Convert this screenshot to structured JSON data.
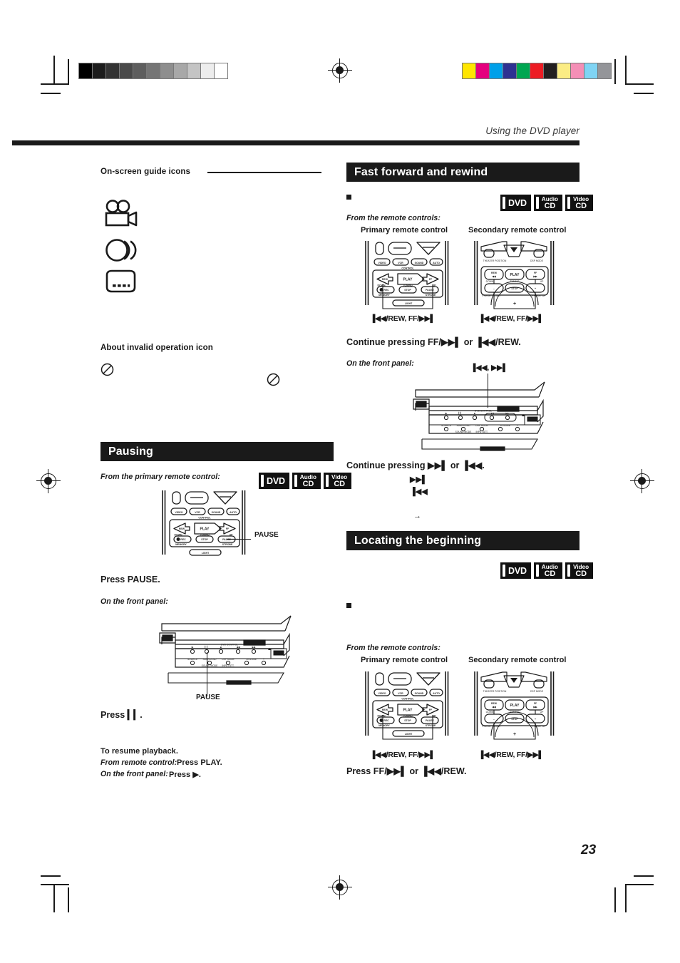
{
  "page": {
    "running_head": "Using the DVD player",
    "number": "23"
  },
  "registration": {
    "gray_wedge": [
      "#000000",
      "#1c1c1c",
      "#333333",
      "#4a4a4a",
      "#5e5e5e",
      "#757575",
      "#8e8e8e",
      "#a8a8a8",
      "#c4c4c4",
      "#ededed",
      "#ffffff"
    ],
    "color_bars": [
      "#ffe600",
      "#e5007e",
      "#00a0e9",
      "#2e3192",
      "#00a651",
      "#ed1c24",
      "#231f20",
      "#fbec84",
      "#f48fb6",
      "#7fd4f4",
      "#949599"
    ]
  },
  "left_column": {
    "guide_icons_heading": "On-screen guide icons",
    "guide_icons": [
      {
        "name": "video-camera-icon"
      },
      {
        "name": "audio-discs-icon"
      },
      {
        "name": "subtitle-screen-icon"
      }
    ],
    "invalid_heading": "About invalid operation icon",
    "invalid_icon_name": "no-entry-icon",
    "pausing": {
      "title": "Pausing",
      "from_remote": "From the primary remote control:",
      "badges": [
        "DVD",
        "Audio CD",
        "Video CD"
      ],
      "remote_callout": "PAUSE",
      "press_instruction": "Press PAUSE.",
      "front_panel_label": "On the front panel:",
      "front_panel_callout": "PAUSE",
      "front_panel_press_prefix": "Press",
      "front_panel_press_glyph": "▐▌",
      "front_panel_press_suffix": ".",
      "resume_title": "To resume playback.",
      "resume_rows": [
        {
          "label": "From remote control:",
          "value": "Press PLAY."
        },
        {
          "label": "On the front panel:",
          "value": "Press ▶."
        }
      ]
    }
  },
  "right_column": {
    "fast_forward": {
      "title": "Fast forward and rewind",
      "badges": [
        "DVD",
        "Audio CD",
        "Video CD"
      ],
      "from_remotes": "From the remote controls:",
      "primary_label": "Primary remote control",
      "secondary_label": "Secondary remote control",
      "primary_callout": "▐◀◀/REW, FF/▶▶▌",
      "secondary_callout": "▐◀◀/REW, FF/▶▶▌",
      "instruction": "Continue pressing FF/▶▶▌ or ▐◀◀/REW.",
      "front_panel_label": "On the front panel:",
      "front_panel_callout": "▐◀◀, ▶▶▌",
      "front_instruction": "Continue pressing ▶▶▌ or ▐◀◀.",
      "glyph_forward": "▶▶▌",
      "glyph_back": "▐◀◀",
      "arrow": "→"
    },
    "locating": {
      "title": "Locating the beginning",
      "badges": [
        "DVD",
        "Audio CD",
        "Video CD"
      ],
      "from_remotes": "From the remote controls:",
      "primary_label": "Primary remote control",
      "secondary_label": "Secondary remote control",
      "primary_callout": "▐◀◀/REW, FF/▶▶▌",
      "secondary_callout": "▐◀◀/REW, FF/▶▶▌",
      "instruction": "Press FF/▶▶▌ or ▐◀◀/REW."
    }
  },
  "primary_remote": {
    "top_buttons": [
      "VIDEO",
      "VCR",
      "SOUND",
      "AUTO"
    ],
    "control_label": "CONTROL",
    "transport": [
      "REW",
      "PLAY",
      "FF"
    ],
    "tuning_left": "DOWN",
    "tuning_center": "TUNING",
    "tuning_right": "UP",
    "row3": [
      "REC",
      "STOP",
      "PAUSE"
    ],
    "row3_sub": [
      "MEMORY",
      "",
      "STROBE"
    ],
    "light_button": "LIGHT"
  },
  "secondary_remote": {
    "theater_label": "THEATER POSITION",
    "dsp_label": "DSP MODE",
    "transport": [
      "REW",
      "PLAY",
      "FF"
    ],
    "tuning_left": "DOWN",
    "tuning_center": "TUNING",
    "tuning_right": "UP",
    "row3": [
      "–",
      "STOP",
      "+"
    ],
    "preset_left": "PRESET DOWN",
    "preset_right": "PRESET UP",
    "volume_plus": "+"
  },
  "front_panel": {
    "control_label": "DVD CONTROL",
    "bottom_labels": [
      "SOURCE",
      "SURROUND",
      "DSP MODE",
      "VOLUME"
    ],
    "bottom_sublabels": [
      "",
      "SOUND MODE",
      "INPUT ATT."
    ],
    "brand": "DVD"
  }
}
